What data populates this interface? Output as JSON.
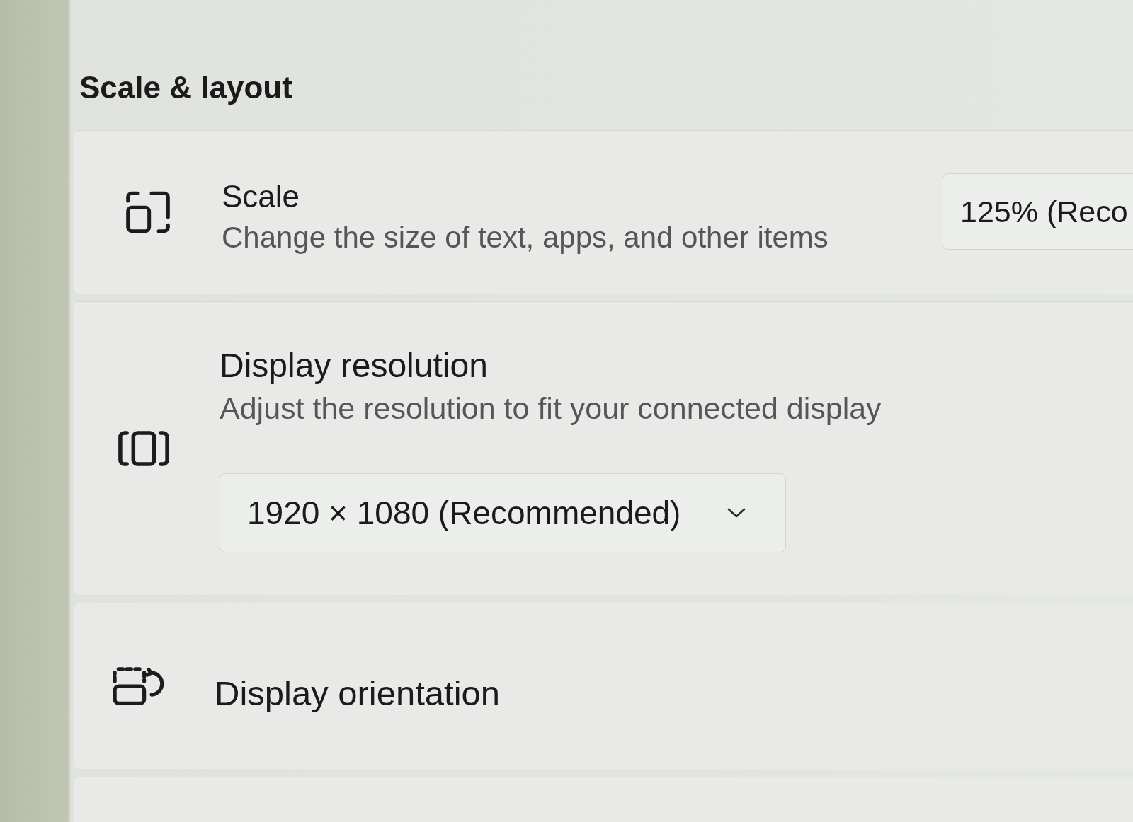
{
  "section": {
    "title": "Scale & layout"
  },
  "settings": [
    {
      "kind": "dropdown-right",
      "title": "Scale",
      "description": "Change the size of text, apps, and other items",
      "value": "125% (Reco"
    },
    {
      "kind": "dropdown-below",
      "title": "Display resolution",
      "description": "Adjust the resolution to fit your connected display",
      "value": "1920 × 1080 (Recommended)"
    },
    {
      "kind": "plain",
      "title": "Display orientation"
    },
    {
      "kind": "empty"
    }
  ]
}
